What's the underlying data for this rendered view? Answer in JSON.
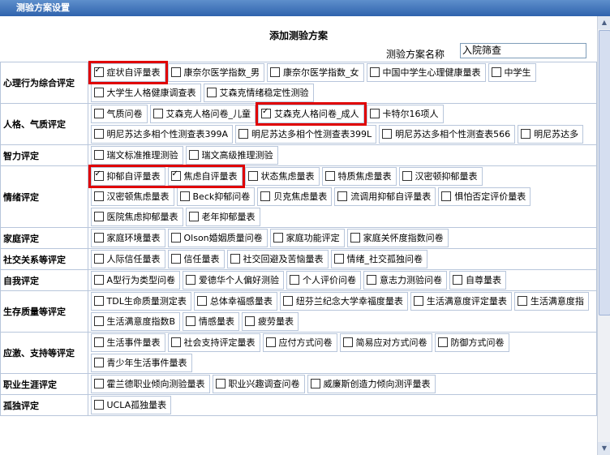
{
  "window": {
    "title": "测验方案设置"
  },
  "form": {
    "title": "添加测验方案",
    "name_label": "测验方案名称",
    "name_value": "入院筛查"
  },
  "categories": [
    {
      "name": "心理行为综合评定",
      "rows": [
        [
          {
            "label": "症状自评量表",
            "checked": true
          },
          {
            "label": "康奈尔医学指数_男"
          },
          {
            "label": "康奈尔医学指数_女"
          },
          {
            "label": "中国中学生心理健康量表"
          },
          {
            "label": "中学生"
          }
        ],
        [
          {
            "label": "大学生人格健康调查表"
          },
          {
            "label": "艾森克情绪稳定性测验"
          }
        ]
      ]
    },
    {
      "name": "人格、气质评定",
      "rows": [
        [
          {
            "label": "气质问卷"
          },
          {
            "label": "艾森克人格问卷_儿童"
          },
          {
            "label": "艾森克人格问卷_成人",
            "checked": true
          },
          {
            "label": "卡特尔16项人"
          }
        ],
        [
          {
            "label": "明尼苏达多相个性测查表399A"
          },
          {
            "label": "明尼苏达多相个性测查表399L"
          },
          {
            "label": "明尼苏达多相个性测查表566"
          },
          {
            "label": "明尼苏达多"
          }
        ]
      ]
    },
    {
      "name": "智力评定",
      "rows": [
        [
          {
            "label": "瑞文标准推理测验"
          },
          {
            "label": "瑞文高级推理测验"
          }
        ]
      ]
    },
    {
      "name": "情绪评定",
      "rows": [
        [
          {
            "label": "抑郁自评量表",
            "checked": true
          },
          {
            "label": "焦虑自评量表",
            "checked": true
          },
          {
            "label": "状态焦虑量表"
          },
          {
            "label": "特质焦虑量表"
          },
          {
            "label": "汉密顿抑郁量表"
          }
        ],
        [
          {
            "label": "汉密顿焦虑量表"
          },
          {
            "label": "Beck抑郁问卷"
          },
          {
            "label": "贝克焦虑量表"
          },
          {
            "label": "流调用抑郁自评量表"
          },
          {
            "label": "惧怕否定评价量表"
          }
        ],
        [
          {
            "label": "医院焦虑抑郁量表"
          },
          {
            "label": "老年抑郁量表"
          }
        ]
      ]
    },
    {
      "name": "家庭评定",
      "rows": [
        [
          {
            "label": "家庭环境量表"
          },
          {
            "label": "Olson婚姻质量问卷"
          },
          {
            "label": "家庭功能评定"
          },
          {
            "label": "家庭关怀度指数问卷"
          }
        ]
      ]
    },
    {
      "name": "社交关系等评定",
      "rows": [
        [
          {
            "label": "人际信任量表"
          },
          {
            "label": "信任量表"
          },
          {
            "label": "社交回避及苦恼量表"
          },
          {
            "label": "情绪_社交孤独问卷"
          }
        ]
      ]
    },
    {
      "name": "自我评定",
      "rows": [
        [
          {
            "label": "A型行为类型问卷"
          },
          {
            "label": "爱德华个人偏好测验"
          },
          {
            "label": "个人评价问卷"
          },
          {
            "label": "意志力测验问卷"
          },
          {
            "label": "自尊量表"
          }
        ]
      ]
    },
    {
      "name": "生存质量等评定",
      "rows": [
        [
          {
            "label": "TDL生命质量测定表"
          },
          {
            "label": "总体幸福感量表"
          },
          {
            "label": "纽芬兰纪念大学幸福度量表"
          },
          {
            "label": "生活满意度评定量表"
          },
          {
            "label": "生活满意度指"
          }
        ],
        [
          {
            "label": "生活满意度指数B"
          },
          {
            "label": "情感量表"
          },
          {
            "label": "疲劳量表"
          }
        ]
      ]
    },
    {
      "name": "应激、支持等评定",
      "rows": [
        [
          {
            "label": "生活事件量表"
          },
          {
            "label": "社会支持评定量表"
          },
          {
            "label": "应付方式问卷"
          },
          {
            "label": "简易应对方式问卷"
          },
          {
            "label": "防御方式问卷"
          }
        ],
        [
          {
            "label": "青少年生活事件量表"
          }
        ]
      ]
    },
    {
      "name": "职业生涯评定",
      "rows": [
        [
          {
            "label": "霍兰德职业倾向测验量表"
          },
          {
            "label": "职业兴趣调查问卷"
          },
          {
            "label": "威廉斯创造力倾向测评量表"
          }
        ]
      ]
    },
    {
      "name": "孤独评定",
      "rows": [
        [
          {
            "label": "UCLA孤独量表"
          }
        ]
      ]
    }
  ],
  "highlight_color": "#e00000"
}
